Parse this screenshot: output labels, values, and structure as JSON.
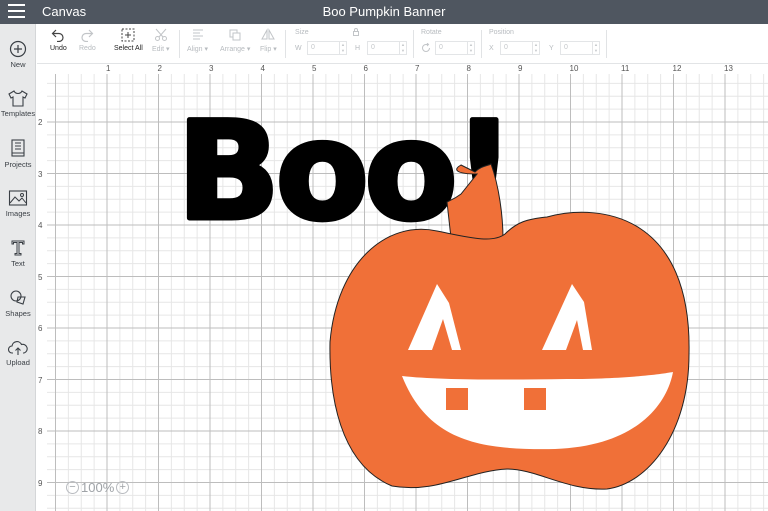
{
  "topbar": {
    "app_label": "Canvas",
    "document_title": "Boo Pumpkin Banner"
  },
  "sidebar": {
    "items": [
      {
        "label": "New",
        "icon": "plus-circle-icon"
      },
      {
        "label": "Templates",
        "icon": "shirt-icon"
      },
      {
        "label": "Projects",
        "icon": "projects-icon"
      },
      {
        "label": "Images",
        "icon": "image-icon"
      },
      {
        "label": "Text",
        "icon": "text-t-icon"
      },
      {
        "label": "Shapes",
        "icon": "shapes-icon"
      },
      {
        "label": "Upload",
        "icon": "cloud-upload-icon"
      }
    ]
  },
  "toolbar": {
    "undo": "Undo",
    "redo": "Redo",
    "select_all": "Select All",
    "edit": "Edit",
    "align": "Align",
    "arrange": "Arrange",
    "flip": "Flip",
    "size_label": "Size",
    "w_label": "W",
    "h_label": "H",
    "w_value": "0",
    "h_value": "0",
    "rotate_label": "Rotate",
    "rotate_value": "0",
    "position_label": "Position",
    "x_label": "X",
    "y_label": "Y",
    "x_value": "0",
    "y_value": "0"
  },
  "rulers": {
    "top": [
      "1",
      "2",
      "3",
      "4",
      "5",
      "6",
      "7",
      "8",
      "9",
      "10",
      "11",
      "12",
      "13"
    ],
    "left": [
      "2",
      "3",
      "4",
      "5",
      "6",
      "7",
      "8",
      "9"
    ]
  },
  "design": {
    "text": "Boo!",
    "text_color": "#000000",
    "pumpkin_color": "#f07038",
    "cutout_color": "#ffffff"
  },
  "zoom": {
    "minus": "−",
    "value": "100%",
    "plus": "+"
  }
}
